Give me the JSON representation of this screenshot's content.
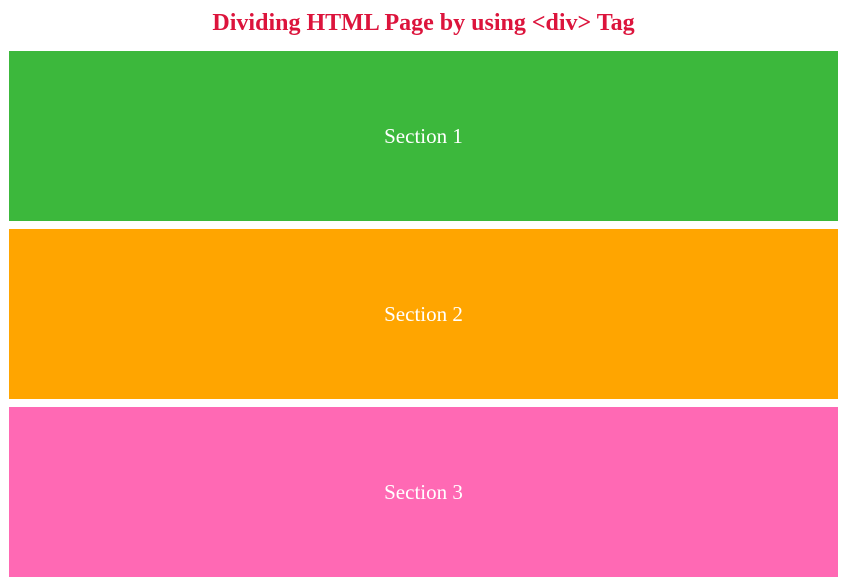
{
  "title": "Dividing HTML Page by using <div> Tag",
  "sections": [
    {
      "label": "Section 1",
      "color": "#3CB83C"
    },
    {
      "label": "Section 2",
      "color": "#FFA500"
    },
    {
      "label": "Section 3",
      "color": "#FF69B4"
    }
  ]
}
